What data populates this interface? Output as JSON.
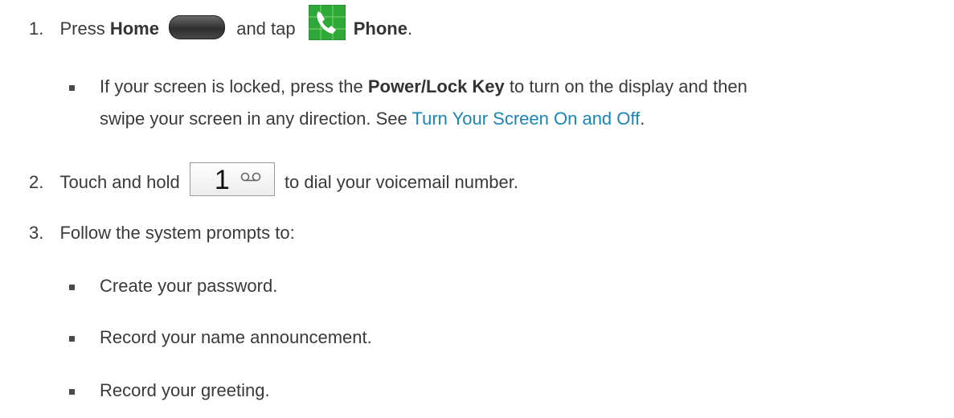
{
  "steps": {
    "s1": {
      "num": "1.",
      "t1": "Press ",
      "home": "Home",
      "t2": " and tap ",
      "phone": "Phone",
      "t3": "."
    },
    "s1_bullet": {
      "t1": "If your screen is locked, press the ",
      "key": "Power/Lock Key",
      "t2": " to turn on the display and then",
      "t3": "swipe your screen in any direction. See ",
      "link": "Turn Your Screen On and Off",
      "t4": "."
    },
    "s2": {
      "num": "2.",
      "t1": "Touch and hold ",
      "key_digit": "1",
      "t2": " to dial your voicemail number."
    },
    "s3": {
      "num": "3.",
      "t1": "Follow the system prompts to:"
    },
    "s3_bullets": [
      "Create your password.",
      "Record your name announcement.",
      "Record your greeting."
    ]
  },
  "colors": {
    "link": "#1a86b8",
    "text": "#3a3a3a",
    "phone_icon": "#2fa83a"
  },
  "icons": {
    "home": "home-key-icon",
    "phone": "phone-app-icon",
    "voicemail": "voicemail-icon"
  }
}
